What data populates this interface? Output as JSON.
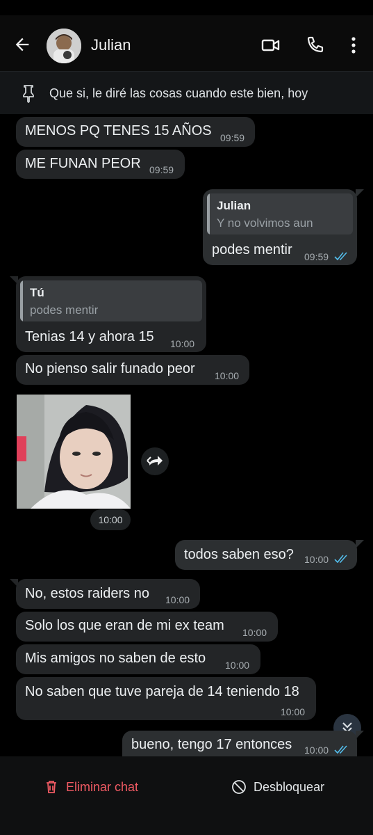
{
  "header": {
    "contact_name": "Julian",
    "icons": [
      "back-arrow-icon",
      "video-call-icon",
      "phone-icon",
      "more-vert-icon"
    ]
  },
  "pinned": {
    "text": "Que si, le diré las cosas cuando este bien, hoy",
    "icon": "pin-icon"
  },
  "messages": [
    {
      "dir": "in",
      "text": "MENOS PQ TENES 15 AÑOS",
      "time": "09:59"
    },
    {
      "dir": "in",
      "text": "ME FUNAN PEOR",
      "time": "09:59"
    },
    {
      "dir": "out",
      "quote_name": "Julian",
      "quote_text": "Y no volvimos aun",
      "text": "podes mentir",
      "time": "09:59",
      "status": "read"
    },
    {
      "dir": "in",
      "quote_name": "Tú",
      "quote_text": "podes mentir",
      "text": "Tenias 14 y ahora 15",
      "time": "10:00"
    },
    {
      "dir": "in",
      "text": "No pienso salir funado peor",
      "time": "10:00"
    },
    {
      "dir": "in",
      "type": "image",
      "time": "10:00"
    },
    {
      "dir": "out",
      "text": "todos saben eso?",
      "time": "10:00",
      "status": "read"
    },
    {
      "dir": "in",
      "text": "No, estos raiders no",
      "time": "10:00"
    },
    {
      "dir": "in",
      "text": "Solo los que eran de mi ex team",
      "time": "10:00"
    },
    {
      "dir": "in",
      "text": "Mis amigos no saben de esto",
      "time": "10:00"
    },
    {
      "dir": "in",
      "text": "No saben que tuve pareja de 14 teniendo 18",
      "time": "10:00"
    },
    {
      "dir": "out",
      "text": "bueno, tengo 17 entonces",
      "time": "10:00",
      "status": "read"
    }
  ],
  "bottom": {
    "delete_label": "Eliminar chat",
    "unblock_label": "Desbloquear"
  },
  "colors": {
    "background": "#000000",
    "incoming_bubble": "#232527",
    "outgoing_bubble": "#2c2f31",
    "read_ticks": "#53bdeb",
    "danger": "#ef5a63"
  }
}
